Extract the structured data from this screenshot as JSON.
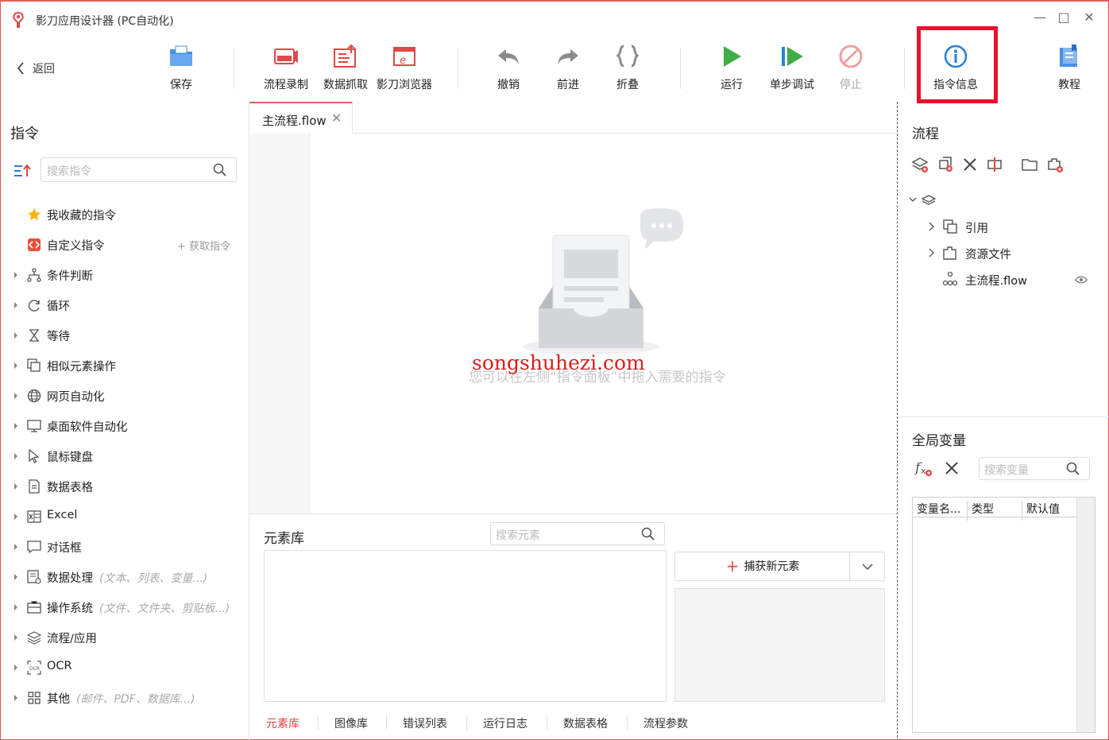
{
  "window": {
    "title": "影刀应用设计器 (PC自动化)",
    "accent_color": "#e06060",
    "highlight_color": "#e8102c"
  },
  "toolbar": {
    "back_label": "返回",
    "save_label": "保存",
    "record_label": "流程录制",
    "scrape_label": "数据抓取",
    "browser_label": "影刀浏览器",
    "undo_label": "撤销",
    "redo_label": "前进",
    "fold_label": "折叠",
    "run_label": "运行",
    "step_label": "单步调试",
    "stop_label": "停止",
    "info_label": "指令信息",
    "tutorial_label": "教程"
  },
  "commands": {
    "title": "指令",
    "search_placeholder": "搜索指令",
    "get_commands_label": "+ 获取指令",
    "items": [
      {
        "label": "我收藏的指令",
        "hint": "",
        "icon": "star-icon"
      },
      {
        "label": "自定义指令",
        "hint": "",
        "icon": "custom-command-icon"
      },
      {
        "label": "条件判断",
        "hint": "",
        "icon": "branch-icon"
      },
      {
        "label": "循环",
        "hint": "",
        "icon": "loop-icon"
      },
      {
        "label": "等待",
        "hint": "",
        "icon": "hourglass-icon"
      },
      {
        "label": "相似元素操作",
        "hint": "",
        "icon": "similar-elements-icon"
      },
      {
        "label": "网页自动化",
        "hint": "",
        "icon": "globe-icon"
      },
      {
        "label": "桌面软件自动化",
        "hint": "",
        "icon": "monitor-icon"
      },
      {
        "label": "鼠标键盘",
        "hint": "",
        "icon": "cursor-icon"
      },
      {
        "label": "数据表格",
        "hint": "",
        "icon": "sheet-icon"
      },
      {
        "label": "Excel",
        "hint": "",
        "icon": "excel-icon"
      },
      {
        "label": "对话框",
        "hint": "",
        "icon": "dialog-icon"
      },
      {
        "label": "数据处理",
        "hint": "(文本、列表、变量...)",
        "icon": "data-processing-icon"
      },
      {
        "label": "操作系统",
        "hint": "(文件、文件夹、剪贴板...)",
        "icon": "os-icon"
      },
      {
        "label": "流程/应用",
        "hint": "",
        "icon": "layers-icon"
      },
      {
        "label": "OCR",
        "hint": "",
        "icon": "ocr-icon"
      },
      {
        "label": "其他",
        "hint": "(邮件、PDF、数据库...)",
        "icon": "grid-icon"
      }
    ]
  },
  "editor": {
    "tab_label": "主流程.flow",
    "empty_hint": "您可以在左侧“指令面板”中拖入需要的指令",
    "watermark": "songshuhezi.com"
  },
  "elements": {
    "title": "元素库",
    "search_placeholder": "搜索元素",
    "capture_label": "捕获新元素",
    "tabs": [
      "元素库",
      "图像库",
      "错误列表",
      "运行日志",
      "数据表格",
      "流程参数"
    ]
  },
  "flow_panel": {
    "title": "流程",
    "tree": [
      "引用",
      "资源文件",
      "主流程.flow"
    ]
  },
  "variables": {
    "title": "全局变量",
    "search_placeholder": "搜索变量",
    "columns": [
      "变量名...",
      "类型",
      "默认值"
    ]
  }
}
